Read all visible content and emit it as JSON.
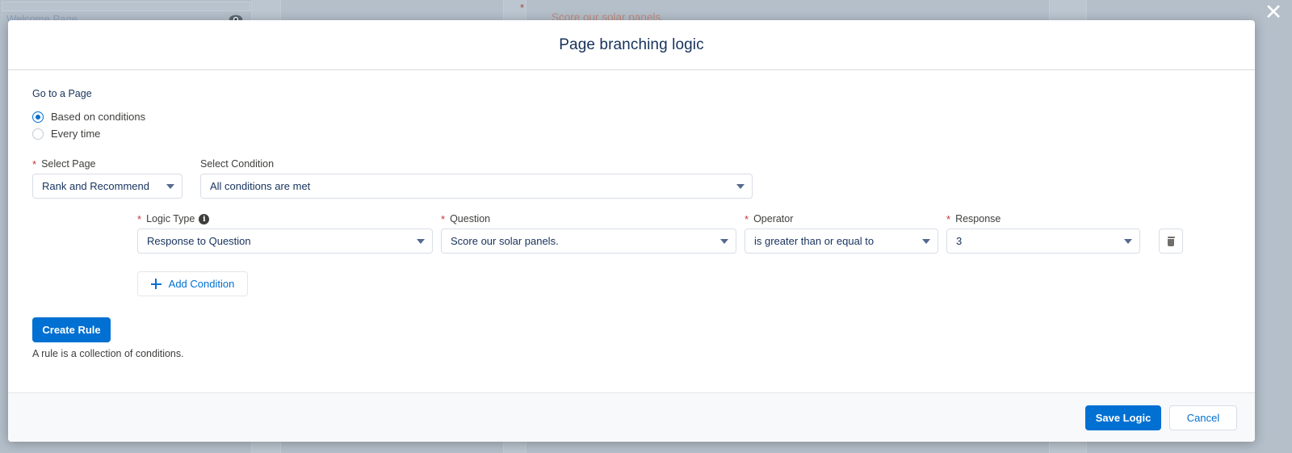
{
  "background": {
    "page_tab_label": "Welcome Page",
    "question_label": "Score our solar panels.",
    "required_marker": "*",
    "eye_icon": "visibility-eye-icon",
    "close_label": "✕"
  },
  "modal": {
    "title": "Page branching logic",
    "go_to_page_label": "Go to a Page",
    "radios": [
      {
        "label": "Based on conditions",
        "checked": true
      },
      {
        "label": "Every time",
        "checked": false
      }
    ],
    "select_page": {
      "label": "Select Page",
      "required": "*",
      "value": "Rank and Recommend"
    },
    "select_condition": {
      "label": "Select Condition",
      "value": "All conditions are met"
    },
    "condition": {
      "logic_type": {
        "label": "Logic Type",
        "required": "*",
        "info_icon": "info-circle-icon",
        "info_glyph": "i",
        "value": "Response to Question"
      },
      "question": {
        "label": "Question",
        "required": "*",
        "value": "Score our solar panels."
      },
      "operator": {
        "label": "Operator",
        "required": "*",
        "value": "is greater than or equal to"
      },
      "response": {
        "label": "Response",
        "required": "*",
        "value": "3"
      },
      "delete_icon": "trash-icon"
    },
    "add_condition_label": "Add Condition",
    "create_rule_label": "Create Rule",
    "rule_helper_text": "A rule is a collection of conditions.",
    "footer": {
      "save_label": "Save Logic",
      "cancel_label": "Cancel"
    }
  },
  "colors": {
    "accent": "#0070d2",
    "required": "#c23934",
    "title": "#16325c",
    "backdrop": "#aeb9c4"
  }
}
